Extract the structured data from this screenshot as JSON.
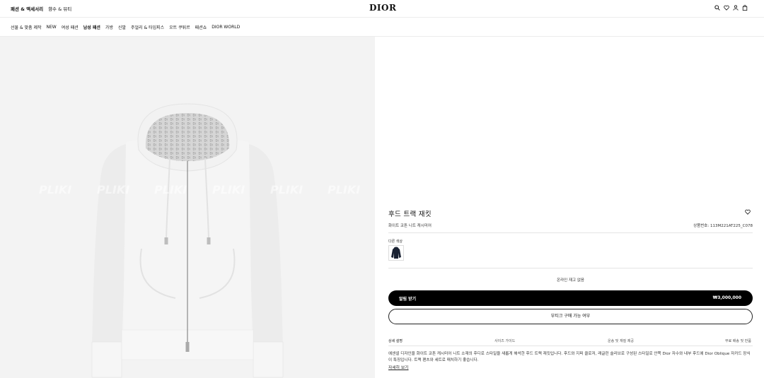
{
  "header": {
    "top_links": [
      "패션 & 액세서리",
      "향수 & 뷰티"
    ],
    "logo": "DIOR",
    "icons": [
      "search-icon",
      "heart-icon",
      "account-icon",
      "bag-icon"
    ]
  },
  "nav": {
    "items": [
      "선물 & 맞춤 제작",
      "NEW",
      "여성 패션",
      "남성 패션",
      "가방",
      "신발",
      "주얼리 & 타임피스",
      "오트 쿠튀르",
      "패션쇼",
      "DIOR WORLD"
    ]
  },
  "product": {
    "watermark": "PLIKI",
    "title": "후드 트랙 재킷",
    "subtitle": "화이트 코튼 니트 캐시미어",
    "code": "상품번호: 113M221AT225_C078",
    "color_label": "다른 색상",
    "stock_status": "온라인 재고 없음",
    "cta_label": "알림 받기",
    "price": "₩3,000,000",
    "boutique_label": "부티크 구매 가능 여부",
    "tabs": [
      "상세 설명",
      "사이즈 가이드",
      "운송 및 재질 제공",
      "무료 배송 및 반품"
    ],
    "description": "에센셜 디자인을 화이트 코튼 캐시미어 니트 소재의 후디로 스타일을 새롭게 해석한 후드 트랙 재킷입니다. 후드와 지퍼 클로저, 래글런 슬리브로 구성된 스타일로 안쪽 Dior 자수와 내부 후드에 Dior Oblique 자카드 장식이 특징입니다. 트랙 팬츠와 세트로 매치하기 좋습니다.",
    "more_link": "자세히 보기"
  },
  "colors": {
    "accent": "#000000",
    "panel_bg": "#f3f3f3",
    "swatch_color": "#1a2233"
  }
}
